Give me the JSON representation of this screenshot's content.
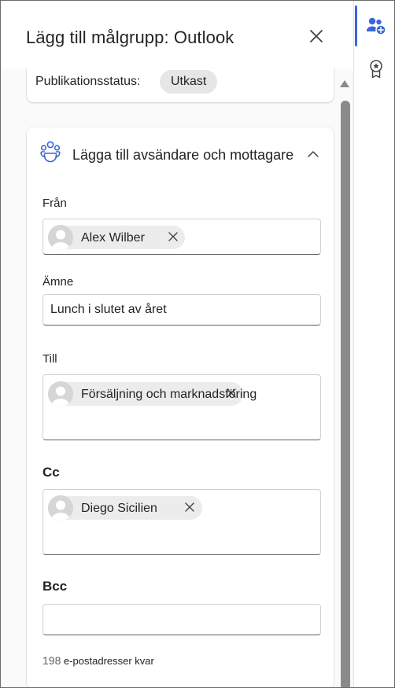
{
  "panel": {
    "title": "Lägg till målgrupp: Outlook",
    "close_icon": "close-icon"
  },
  "status": {
    "label": "Publikationsstatus:",
    "value": "Utkast"
  },
  "section": {
    "heading": "Lägga till avsändare och mottagare",
    "icon": "people-group-icon",
    "expanded": true
  },
  "fields": {
    "from": {
      "label": "Från",
      "chips": [
        {
          "name": "Alex Wilber"
        }
      ]
    },
    "subject": {
      "label": "Ämne",
      "value": "Lunch i slutet av året"
    },
    "to": {
      "label": "Till",
      "chips": [
        {
          "name": "Försäljning och marknadsföring"
        }
      ]
    },
    "cc": {
      "label": "Cc",
      "chips": [
        {
          "name": "Diego Sicilien"
        }
      ]
    },
    "bcc": {
      "label": "Bcc",
      "value": ""
    }
  },
  "footer": {
    "remaining_count": "198",
    "remaining_text": "e-postadresser kvar"
  },
  "rail": {
    "items": [
      {
        "icon": "add-people-icon",
        "selected": true
      },
      {
        "icon": "badge-icon",
        "selected": false
      }
    ]
  },
  "colors": {
    "accent": "#3a66d6",
    "chip_bg": "#ececec",
    "badge_bg": "#e6e6e6"
  }
}
